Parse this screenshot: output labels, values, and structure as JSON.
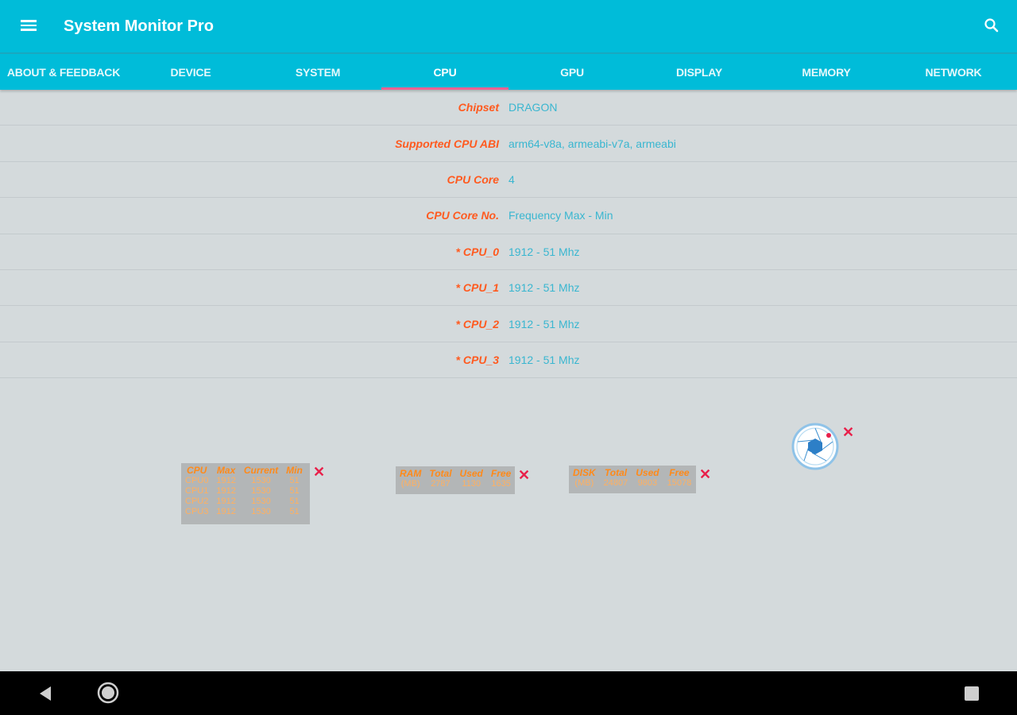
{
  "appbar": {
    "title": "System Monitor Pro"
  },
  "tabs": [
    "ABOUT & FEEDBACK",
    "DEVICE",
    "SYSTEM",
    "CPU",
    "GPU",
    "DISPLAY",
    "MEMORY",
    "NETWORK"
  ],
  "active_tab": "CPU",
  "rows": [
    {
      "label": "Chipset",
      "value": "DRAGON"
    },
    {
      "label": "Supported CPU ABI",
      "value": "arm64-v8a, armeabi-v7a, armeabi"
    },
    {
      "label": "CPU Core",
      "value": "4"
    },
    {
      "label": "CPU Core No.",
      "value": "Frequency Max - Min"
    },
    {
      "label": "* CPU_0",
      "value": "1912 - 51 Mhz"
    },
    {
      "label": "* CPU_1",
      "value": "1912 - 51 Mhz"
    },
    {
      "label": "* CPU_2",
      "value": "1912 - 51 Mhz"
    },
    {
      "label": "* CPU_3",
      "value": "1912 - 51 Mhz"
    }
  ],
  "cpu_widget": {
    "headers": [
      "CPU",
      "Max",
      "Current",
      "Min"
    ],
    "rows": [
      [
        "CPU0",
        "1912",
        "1530",
        "51"
      ],
      [
        "CPU1",
        "1912",
        "1530",
        "51"
      ],
      [
        "CPU2",
        "1912",
        "1530",
        "51"
      ],
      [
        "CPU3",
        "1912",
        "1530",
        "51"
      ]
    ]
  },
  "ram_widget": {
    "headers": [
      "RAM",
      "Total",
      "Used",
      "Free"
    ],
    "rows": [
      [
        "(MB)",
        "2787",
        "1130",
        "1635"
      ]
    ]
  },
  "disk_widget": {
    "headers": [
      "DISK",
      "Total",
      "Used",
      "Free"
    ],
    "rows": [
      [
        "(MB)",
        "24807",
        "9803",
        "15078"
      ]
    ]
  },
  "colors": {
    "primary": "#00bcd9",
    "tab_indicator": "#f06292",
    "label": "#ff5a1f",
    "value": "#39b6d0",
    "close": "#e8204a"
  },
  "icons": {
    "menu": "menu-icon",
    "search": "search-icon",
    "close": "close-icon",
    "capture": "camera-shutter-icon",
    "back": "back-icon",
    "home": "home-icon",
    "recent": "recent-apps-icon"
  }
}
